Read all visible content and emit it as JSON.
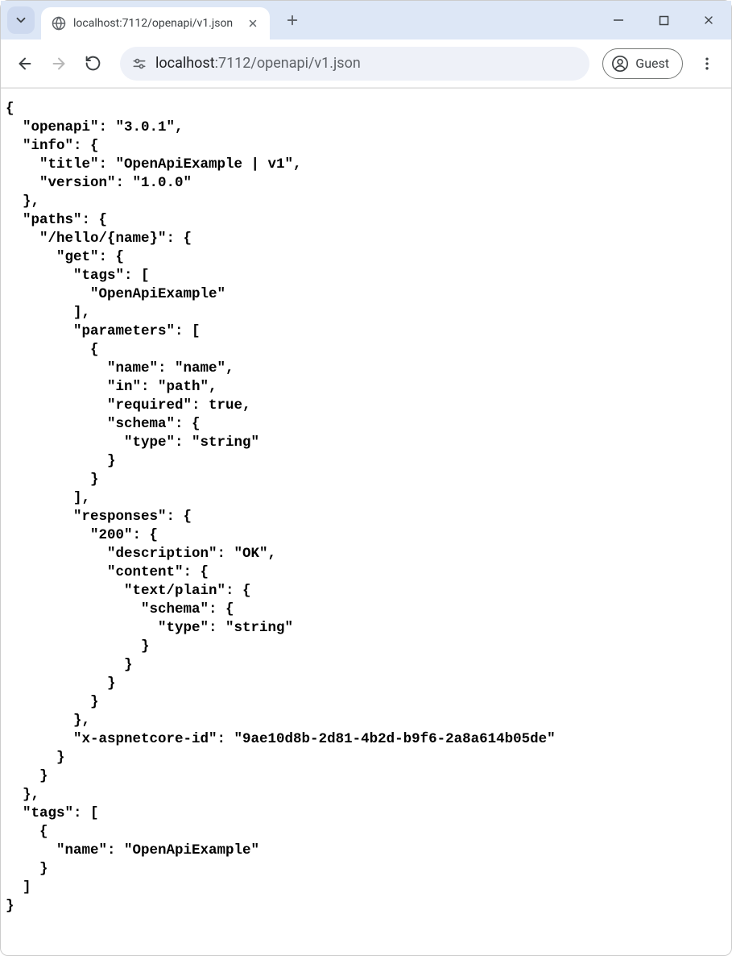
{
  "tab": {
    "title": "localhost:7112/openapi/v1.json"
  },
  "address": {
    "host": "localhost",
    "path": ":7112/openapi/v1.json"
  },
  "profile": {
    "label": "Guest"
  },
  "json": {
    "openapi": "3.0.1",
    "info": {
      "title": "OpenApiExample | v1",
      "version": "1.0.0"
    },
    "paths": {
      "/hello/{name}": {
        "get": {
          "tags": [
            "OpenApiExample"
          ],
          "parameters": [
            {
              "name": "name",
              "in": "path",
              "required": true,
              "schema": {
                "type": "string"
              }
            }
          ],
          "responses": {
            "200": {
              "description": "OK",
              "content": {
                "text/plain": {
                  "schema": {
                    "type": "string"
                  }
                }
              }
            }
          },
          "x-aspnetcore-id": "9ae10d8b-2d81-4b2d-b9f6-2a8a614b05de"
        }
      }
    },
    "tags": [
      {
        "name": "OpenApiExample"
      }
    ]
  }
}
